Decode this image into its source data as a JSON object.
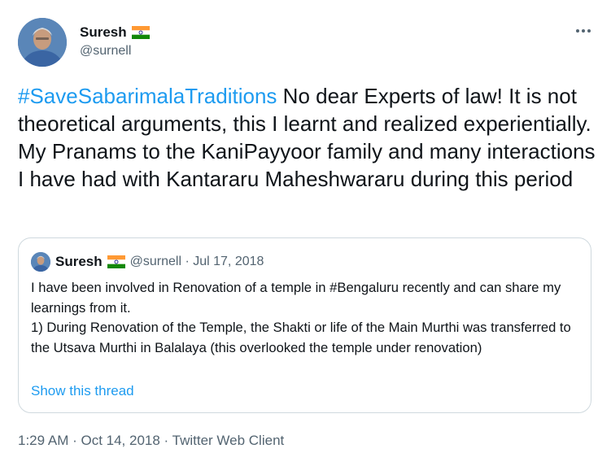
{
  "author": {
    "name": "Suresh",
    "handle": "@surnell",
    "flag_icon": "india-flag-icon"
  },
  "more_icon": "more-horizontal-icon",
  "tweet": {
    "hashtag": "#SaveSabarimalaTraditions",
    "text": " No dear Experts of law! It is not theoretical arguments, this I learnt and realized experientially. My Pranams to the KaniPayyoor family and many interactions I have had with  Kantararu Maheshwararu during this period"
  },
  "quoted_tweet": {
    "name": "Suresh",
    "meta": "@surnell · Jul 17, 2018",
    "lines": [
      "I have been involved in Renovation of a temple in #Bengaluru recently and can share my learnings from it.",
      "1) During Renovation of the Temple, the Shakti or life of the Main Murthi was transferred to the Utsava Murthi in Balalaya (this overlooked the temple under renovation)"
    ],
    "show_thread": "Show this thread"
  },
  "timestamp": "1:29 AM · Oct 14, 2018 · Twitter Web Client",
  "colors": {
    "link": "#1d9bf0",
    "text": "#0f1419",
    "secondary": "#536471",
    "border": "#cfd9de"
  }
}
